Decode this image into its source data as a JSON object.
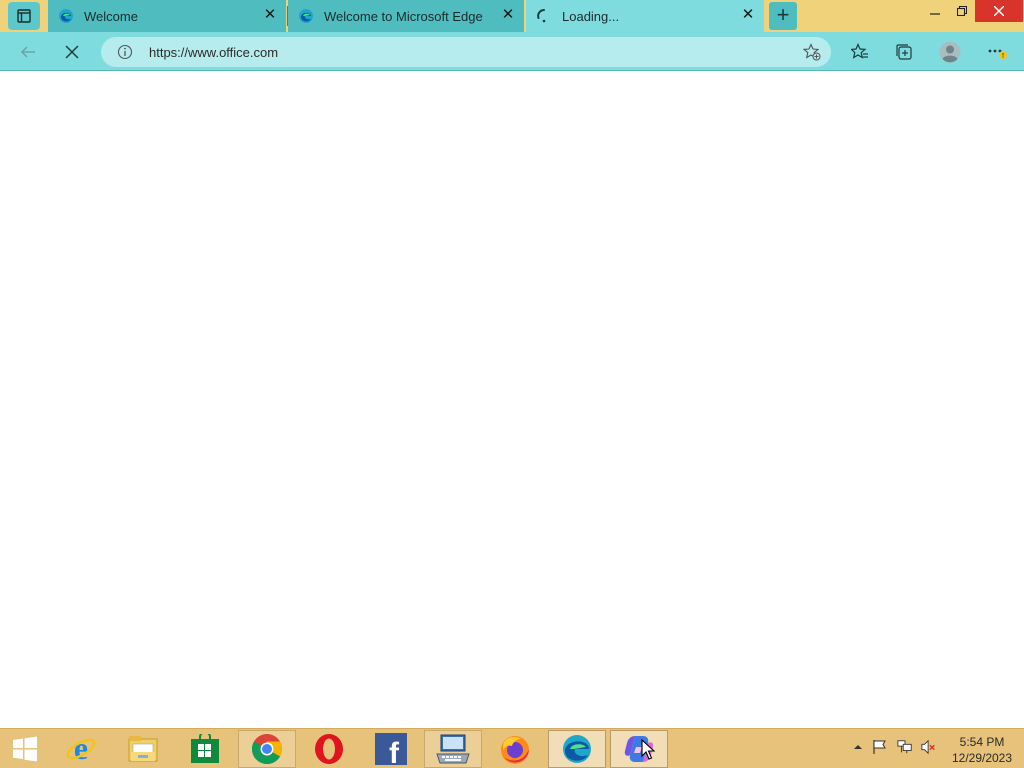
{
  "browser": {
    "tabs": [
      {
        "title": "Welcome",
        "state": "inactive",
        "icon": "edge-icon"
      },
      {
        "title": "Welcome to Microsoft Edge",
        "state": "inactive",
        "icon": "edge-icon"
      },
      {
        "title": "Loading...",
        "state": "active",
        "icon": "loading-spinner-icon"
      }
    ],
    "address_bar": {
      "url": "https://www.office.com"
    },
    "colors": {
      "titlebar": "#f0d27a",
      "tab_inactive": "#4fbdc0",
      "tab_active": "#7fdcde",
      "omnibox": "#b6ecee"
    }
  },
  "taskbar": {
    "apps": [
      {
        "name": "start-button",
        "icon": "windows-logo-icon"
      },
      {
        "name": "internet-explorer",
        "icon": "internet-explorer-icon"
      },
      {
        "name": "file-explorer",
        "icon": "file-explorer-icon"
      },
      {
        "name": "store",
        "icon": "store-icon"
      },
      {
        "name": "chrome",
        "icon": "chrome-icon"
      },
      {
        "name": "opera",
        "icon": "opera-icon"
      },
      {
        "name": "facebook",
        "icon": "facebook-icon"
      },
      {
        "name": "on-screen-keyboard",
        "icon": "keyboard-icon"
      },
      {
        "name": "firefox",
        "icon": "firefox-icon"
      },
      {
        "name": "edge",
        "icon": "edge-icon"
      },
      {
        "name": "copilot",
        "icon": "copilot-icon"
      }
    ],
    "clock": {
      "time": "5:54 PM",
      "date": "12/29/2023"
    }
  }
}
